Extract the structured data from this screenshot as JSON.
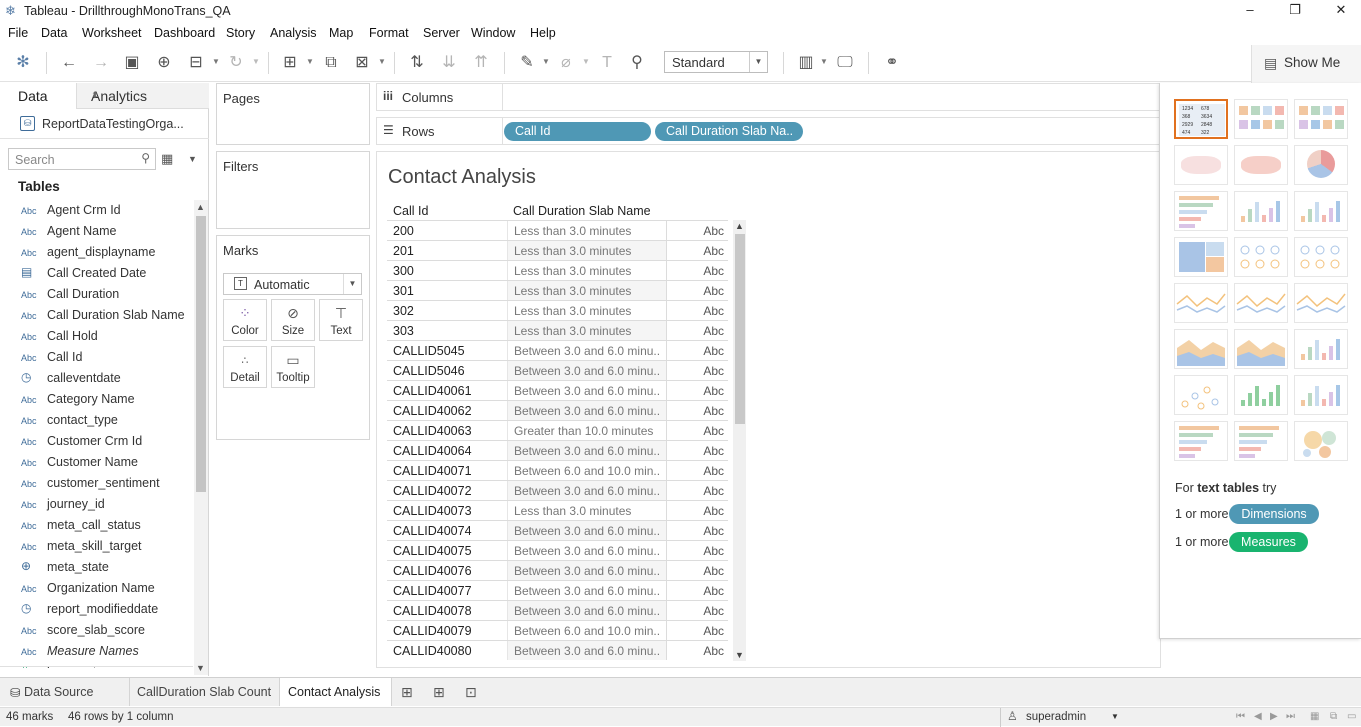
{
  "window": {
    "title": "Tableau - DrillthroughMonoTrans_QA",
    "minimize": "–",
    "restore": "❐",
    "close": "✕"
  },
  "menu": [
    "File",
    "Data",
    "Worksheet",
    "Dashboard",
    "Story",
    "Analysis",
    "Map",
    "Format",
    "Server",
    "Window",
    "Help"
  ],
  "toolbar": {
    "fit_select": "Standard",
    "show_me": "Show Me"
  },
  "data_pane": {
    "tab_data": "Data",
    "tab_analytics": "Analytics",
    "datasource": "ReportDataTestingOrga...",
    "search_placeholder": "Search",
    "tables_heading": "Tables",
    "fields": [
      {
        "type": "Abc",
        "name": "Agent Crm Id"
      },
      {
        "type": "Abc",
        "name": "Agent Name"
      },
      {
        "type": "Abc",
        "name": "agent_displayname"
      },
      {
        "type": "calendar",
        "name": "Call Created Date"
      },
      {
        "type": "Abc",
        "name": "Call Duration"
      },
      {
        "type": "Abc",
        "name": "Call Duration Slab Name"
      },
      {
        "type": "Abc",
        "name": "Call Hold"
      },
      {
        "type": "Abc",
        "name": "Call Id"
      },
      {
        "type": "calendar-clock",
        "name": "calleventdate"
      },
      {
        "type": "Abc",
        "name": "Category Name"
      },
      {
        "type": "Abc",
        "name": "contact_type"
      },
      {
        "type": "Abc",
        "name": "Customer Crm Id"
      },
      {
        "type": "Abc",
        "name": "Customer Name"
      },
      {
        "type": "Abc",
        "name": "customer_sentiment"
      },
      {
        "type": "Abc",
        "name": "journey_id"
      },
      {
        "type": "Abc",
        "name": "meta_call_status"
      },
      {
        "type": "Abc",
        "name": "meta_skill_target"
      },
      {
        "type": "globe",
        "name": "meta_state"
      },
      {
        "type": "Abc",
        "name": "Organization Name"
      },
      {
        "type": "calendar-clock",
        "name": "report_modifieddate"
      },
      {
        "type": "Abc",
        "name": "score_slab_score"
      },
      {
        "type": "Abc",
        "name": "Measure Names",
        "italic": true
      },
      {
        "type": "#",
        "name": "br_agent"
      }
    ]
  },
  "cards": {
    "pages": "Pages",
    "filters": "Filters",
    "marks": "Marks",
    "mark_type": "Automatic",
    "mark_buttons": [
      {
        "label": "Color",
        "icon": "color-icon"
      },
      {
        "label": "Size",
        "icon": "size-icon"
      },
      {
        "label": "Text",
        "icon": "text-icon"
      },
      {
        "label": "Detail",
        "icon": "detail-icon"
      },
      {
        "label": "Tooltip",
        "icon": "tooltip-icon"
      }
    ]
  },
  "shelves": {
    "columns_label": "Columns",
    "rows_label": "Rows",
    "row_pills": [
      "Call Id",
      "Call Duration Slab Na.."
    ]
  },
  "view": {
    "title": "Contact Analysis",
    "col_headers": [
      "Call Id",
      "Call Duration Slab Name"
    ],
    "cell_placeholder": "Abc",
    "rows": [
      [
        "200",
        "Less than 3.0 minutes"
      ],
      [
        "201",
        "Less than 3.0 minutes"
      ],
      [
        "300",
        "Less than 3.0 minutes"
      ],
      [
        "301",
        "Less than 3.0 minutes"
      ],
      [
        "302",
        "Less than 3.0 minutes"
      ],
      [
        "303",
        "Less than 3.0 minutes"
      ],
      [
        "CALLID5045",
        "Between 3.0 and 6.0 minu.."
      ],
      [
        "CALLID5046",
        "Between 3.0 and 6.0 minu.."
      ],
      [
        "CALLID40061",
        "Between 3.0 and 6.0 minu.."
      ],
      [
        "CALLID40062",
        "Between 3.0 and 6.0 minu.."
      ],
      [
        "CALLID40063",
        "Greater than 10.0 minutes"
      ],
      [
        "CALLID40064",
        "Between 3.0 and 6.0 minu.."
      ],
      [
        "CALLID40071",
        "Between 6.0 and 10.0 min.."
      ],
      [
        "CALLID40072",
        "Between 3.0 and 6.0 minu.."
      ],
      [
        "CALLID40073",
        "Less than 3.0 minutes"
      ],
      [
        "CALLID40074",
        "Between 3.0 and 6.0 minu.."
      ],
      [
        "CALLID40075",
        "Between 3.0 and 6.0 minu.."
      ],
      [
        "CALLID40076",
        "Between 3.0 and 6.0 minu.."
      ],
      [
        "CALLID40077",
        "Between 3.0 and 6.0 minu.."
      ],
      [
        "CALLID40078",
        "Between 3.0 and 6.0 minu.."
      ],
      [
        "CALLID40079",
        "Between 6.0 and 10.0 min.."
      ],
      [
        "CALLID40080",
        "Between 3.0 and 6.0 minu.."
      ]
    ]
  },
  "show_me": {
    "hint_prefix": "For ",
    "hint_bold": "text tables",
    "hint_suffix": " try",
    "dim_prefix": "1 or more",
    "dim_label": "Dimensions",
    "meas_prefix": "1 or more",
    "meas_label": "Measures",
    "thumb_text": [
      "1234",
      "678",
      "368",
      "3634",
      "2929",
      "2848",
      "474",
      "322"
    ],
    "colors": {
      "dimensions": "#4f98b5",
      "measures": "#19b46f",
      "selected": "#e1711f"
    }
  },
  "sheet_tabs": [
    {
      "label": "Data Source",
      "icon": "datasource-icon"
    },
    {
      "label": "CallDuration Slab Count"
    },
    {
      "label": "Contact Analysis",
      "active": true
    }
  ],
  "status": {
    "marks": "46 marks",
    "dims": "46 rows by 1 column",
    "user": "superadmin"
  }
}
